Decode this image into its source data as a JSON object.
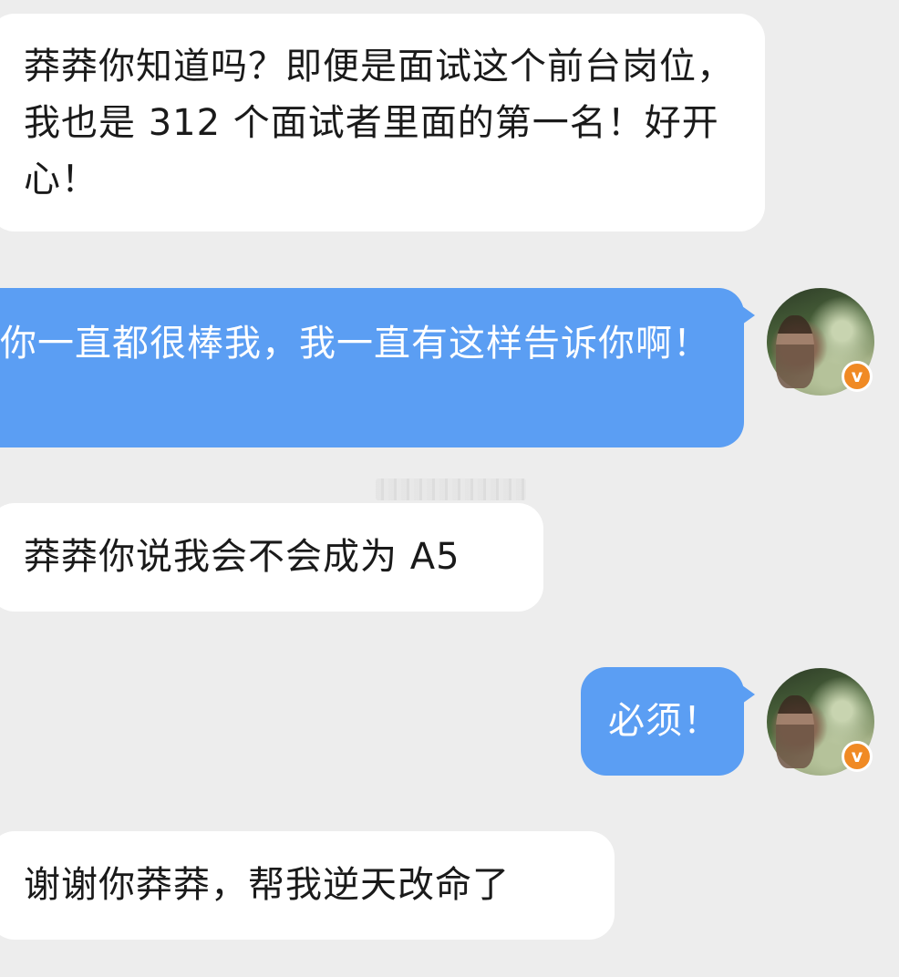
{
  "messages": [
    {
      "id": "m1",
      "side": "incoming",
      "text": "莽莽你知道吗？即便是面试这个前台岗位，我也是 312 个面试者里面的第一名！好开心！"
    },
    {
      "id": "m2",
      "side": "outgoing",
      "text": "你一直都很棒我，我一直有这样告诉你啊！"
    },
    {
      "id": "m3",
      "side": "incoming",
      "text": "莽莽你说我会不会成为 A5"
    },
    {
      "id": "m4",
      "side": "outgoing",
      "text": "必须！"
    },
    {
      "id": "m5",
      "side": "incoming",
      "text": "谢谢你莽莽，帮我逆天改命了"
    }
  ],
  "avatar": {
    "badge_label": "v",
    "badge_color": "#f08a24"
  },
  "colors": {
    "background": "#ededed",
    "incoming_bubble": "#ffffff",
    "outgoing_bubble": "#5b9ef3"
  }
}
